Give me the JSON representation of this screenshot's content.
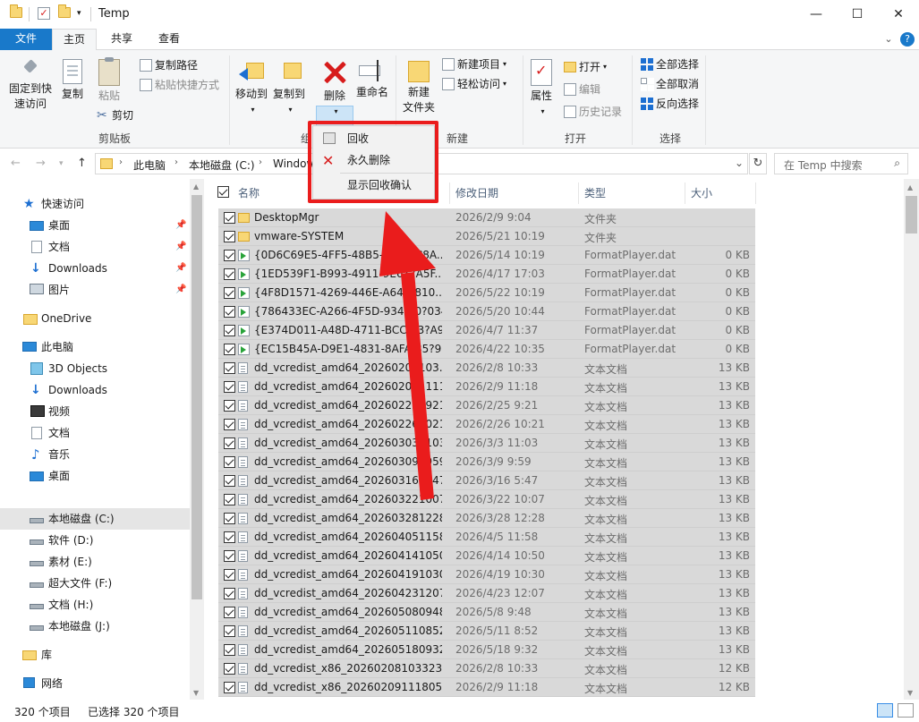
{
  "window": {
    "title": "Temp",
    "minimize": "—",
    "maximize": "☐",
    "close": "✕"
  },
  "ribbon_tabs": {
    "file": "文件",
    "home": "主页",
    "share": "共享",
    "view": "查看",
    "collapse": "⌄",
    "help": "?"
  },
  "clipboard": {
    "pin_label_1": "固定到快",
    "pin_label_2": "速访问",
    "copy": "复制",
    "paste": "粘贴",
    "copy_path": "复制路径",
    "paste_shortcut": "粘贴快捷方式",
    "cut": "剪切",
    "group": "剪贴板"
  },
  "organize": {
    "move_to": "移动到",
    "copy_to": "复制到",
    "delete": "删除",
    "rename": "重命名",
    "group_partial": "组"
  },
  "new_group": {
    "new_item": "新建项目",
    "easy_access": "轻松访问",
    "new_folder_1": "新建",
    "new_folder_2": "文件夹",
    "group": "新建"
  },
  "open_group": {
    "properties": "属性",
    "open": "打开",
    "edit": "编辑",
    "history": "历史记录",
    "group": "打开"
  },
  "select_group": {
    "select_all": "全部选择",
    "select_none": "全部取消",
    "invert": "反向选择",
    "group": "选择"
  },
  "delete_menu": {
    "recycle": "回收",
    "permanent": "永久删除",
    "show_confirm": "显示回收确认"
  },
  "address": {
    "crumb_pc": "此电脑",
    "crumb_c": "本地磁盘 (C:)",
    "crumb_windows": "Windows",
    "search_placeholder": "在 Temp 中搜索"
  },
  "nav": {
    "quick_access": "快速访问",
    "desktop": "桌面",
    "documents": "文档",
    "downloads": "Downloads",
    "pictures": "图片",
    "onedrive": "OneDrive",
    "this_pc": "此电脑",
    "objects3d": "3D Objects",
    "downloads2": "Downloads",
    "videos": "视频",
    "documents2": "文档",
    "music": "音乐",
    "desktop2": "桌面",
    "drive_c": "本地磁盘 (C:)",
    "drive_d": "软件 (D:)",
    "drive_e": "素材 (E:)",
    "drive_f": "超大文件 (F:)",
    "drive_h": "文档 (H:)",
    "drive_j": "本地磁盘 (J:)",
    "libraries": "库",
    "network": "网络"
  },
  "columns": {
    "name": "名称",
    "date": "修改日期",
    "type": "类型",
    "size": "大小"
  },
  "files": [
    {
      "name": "DesktopMgr",
      "date": "2026/2/9 9:04",
      "type": "文件夹",
      "size": "",
      "kind": "folder"
    },
    {
      "name": "vmware-SYSTEM",
      "date": "2026/5/21 10:19",
      "type": "文件夹",
      "size": "",
      "kind": "folder"
    },
    {
      "name": "{0D6C69E5-4FF5-48B5-8?1?9C8A...",
      "date": "2026/5/14 10:19",
      "type": "FormatPlayer.dat",
      "size": "0 KB",
      "kind": "dat"
    },
    {
      "name": "{1ED539F1-B993-4911-9E6?2A5F...",
      "date": "2026/4/17 17:03",
      "type": "FormatPlayer.dat",
      "size": "0 KB",
      "kind": "dat"
    },
    {
      "name": "{4F8D1571-4269-446E-A64B-810...",
      "date": "2026/5/22 10:19",
      "type": "FormatPlayer.dat",
      "size": "0 KB",
      "kind": "dat"
    },
    {
      "name": "{786433EC-A266-4F5D-9345-0?034...",
      "date": "2026/5/20 10:44",
      "type": "FormatPlayer.dat",
      "size": "0 KB",
      "kind": "dat"
    },
    {
      "name": "{E374D011-A48D-4711-BCC3-3?A9...",
      "date": "2026/4/7 11:37",
      "type": "FormatPlayer.dat",
      "size": "0 KB",
      "kind": "dat"
    },
    {
      "name": "{EC15B45A-D9E1-4831-8AFA-B5?9...",
      "date": "2026/4/22 10:35",
      "type": "FormatPlayer.dat",
      "size": "0 KB",
      "kind": "dat"
    },
    {
      "name": "dd_vcredist_amd64_20260208103...",
      "date": "2026/2/8 10:33",
      "type": "文本文档",
      "size": "13 KB",
      "kind": "txt"
    },
    {
      "name": "dd_vcredist_amd64_202602091111...",
      "date": "2026/2/9 11:18",
      "type": "文本文档",
      "size": "13 KB",
      "kind": "txt"
    },
    {
      "name": "dd_vcredist_amd64_202602250921...",
      "date": "2026/2/25 9:21",
      "type": "文本文档",
      "size": "13 KB",
      "kind": "txt"
    },
    {
      "name": "dd_vcredist_amd64_202602261021...",
      "date": "2026/2/26 10:21",
      "type": "文本文档",
      "size": "13 KB",
      "kind": "txt"
    },
    {
      "name": "dd_vcredist_amd64_202603031103...",
      "date": "2026/3/3 11:03",
      "type": "文本文档",
      "size": "13 KB",
      "kind": "txt"
    },
    {
      "name": "dd_vcredist_amd64_202603090959...",
      "date": "2026/3/9 9:59",
      "type": "文本文档",
      "size": "13 KB",
      "kind": "txt"
    },
    {
      "name": "dd_vcredist_amd64_202603160547...",
      "date": "2026/3/16 5:47",
      "type": "文本文档",
      "size": "13 KB",
      "kind": "txt"
    },
    {
      "name": "dd_vcredist_amd64_202603221007...",
      "date": "2026/3/22 10:07",
      "type": "文本文档",
      "size": "13 KB",
      "kind": "txt"
    },
    {
      "name": "dd_vcredist_amd64_202603281228...",
      "date": "2026/3/28 12:28",
      "type": "文本文档",
      "size": "13 KB",
      "kind": "txt"
    },
    {
      "name": "dd_vcredist_amd64_202604051158...",
      "date": "2026/4/5 11:58",
      "type": "文本文档",
      "size": "13 KB",
      "kind": "txt"
    },
    {
      "name": "dd_vcredist_amd64_202604141050...",
      "date": "2026/4/14 10:50",
      "type": "文本文档",
      "size": "13 KB",
      "kind": "txt"
    },
    {
      "name": "dd_vcredist_amd64_202604191030...",
      "date": "2026/4/19 10:30",
      "type": "文本文档",
      "size": "13 KB",
      "kind": "txt"
    },
    {
      "name": "dd_vcredist_amd64_202604231207...",
      "date": "2026/4/23 12:07",
      "type": "文本文档",
      "size": "13 KB",
      "kind": "txt"
    },
    {
      "name": "dd_vcredist_amd64_202605080948...",
      "date": "2026/5/8 9:48",
      "type": "文本文档",
      "size": "13 KB",
      "kind": "txt"
    },
    {
      "name": "dd_vcredist_amd64_202605110852...",
      "date": "2026/5/11 8:52",
      "type": "文本文档",
      "size": "13 KB",
      "kind": "txt"
    },
    {
      "name": "dd_vcredist_amd64_202605180932...",
      "date": "2026/5/18 9:32",
      "type": "文本文档",
      "size": "13 KB",
      "kind": "txt"
    },
    {
      "name": "dd_vcredist_x86_20260208103323.l...",
      "date": "2026/2/8 10:33",
      "type": "文本文档",
      "size": "12 KB",
      "kind": "txt"
    },
    {
      "name": "dd_vcredist_x86_20260209111805.l...",
      "date": "2026/2/9 11:18",
      "type": "文本文档",
      "size": "12 KB",
      "kind": "txt"
    }
  ],
  "status": {
    "count": "320 个项目",
    "selected": "已选择 320 个项目"
  },
  "colors": {
    "accent": "#1979ca",
    "annotation_red": "#ea1c1c",
    "selection_gray": "#d9d9d9"
  }
}
